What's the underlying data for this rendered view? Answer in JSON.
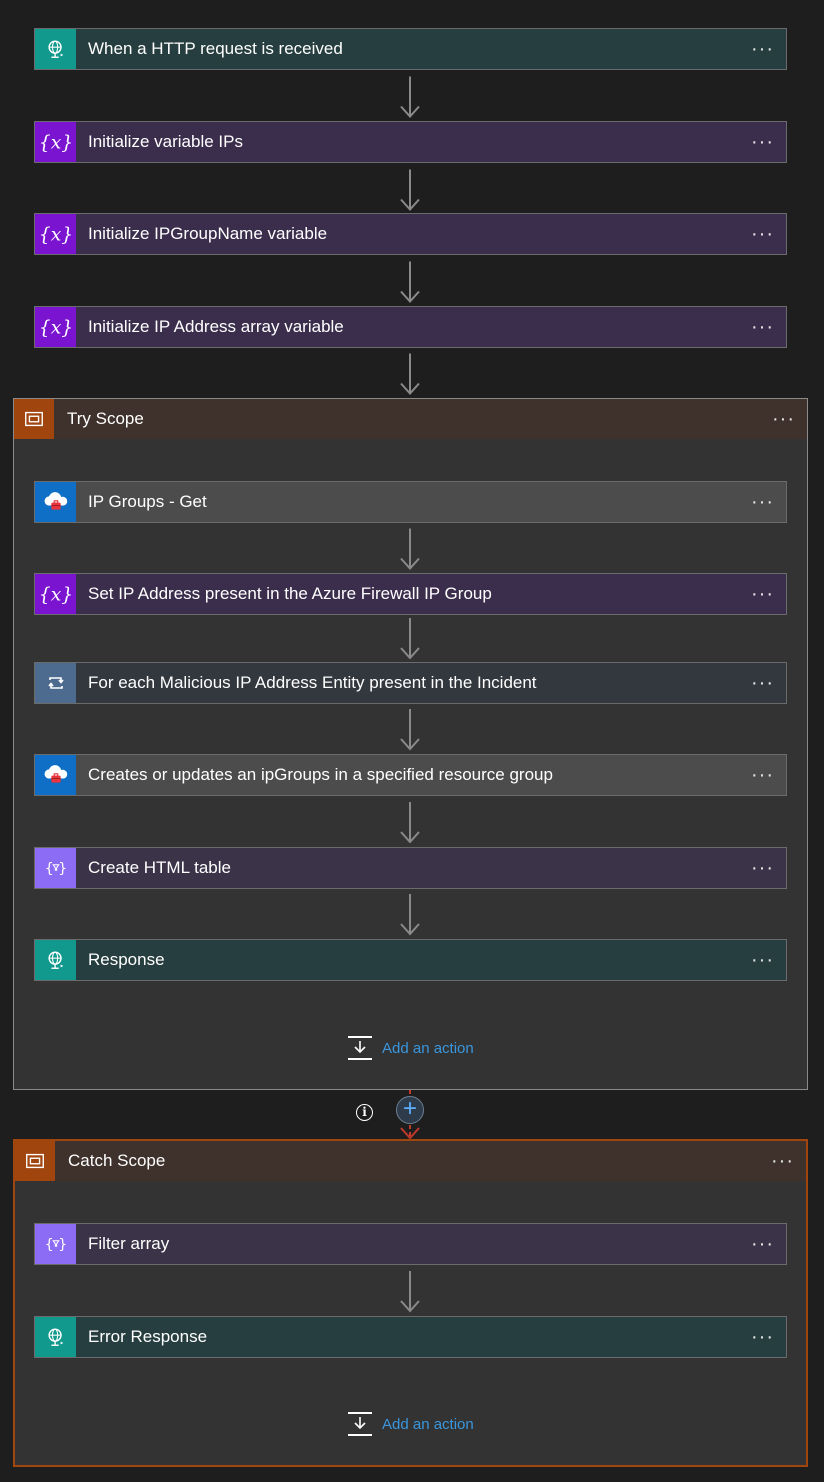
{
  "steps": {
    "http_trigger": "When a HTTP request is received",
    "init_ips": "Initialize variable IPs",
    "init_ipgroupname": "Initialize IPGroupName variable",
    "init_ip_array": "Initialize IP Address array variable"
  },
  "try_scope": {
    "title": "Try Scope",
    "actions": {
      "ip_groups_get": "IP Groups - Get",
      "set_ip_address": "Set IP Address present in the Azure Firewall IP Group",
      "for_each": "For each Malicious IP Address Entity present in the Incident",
      "create_update": "Creates or updates an ipGroups in a specified resource group",
      "create_html": "Create HTML table",
      "response": "Response"
    },
    "add_action": "Add an action"
  },
  "catch_scope": {
    "title": "Catch Scope",
    "actions": {
      "filter_array": "Filter array",
      "error_response": "Error Response"
    },
    "add_action": "Add an action"
  },
  "more_label": "···",
  "info_label": "i",
  "plus_label": "+",
  "colors": {
    "http": "#11998e",
    "variable": "#7a14d1",
    "arm": "#0f6fc6",
    "loop": "#4d6b8f",
    "data_ops": "#8c6cf5",
    "scope": "#a1450f",
    "link": "#3a96dd"
  },
  "icons": {
    "http": "globe-request-icon",
    "variable": "curly-x-icon",
    "arm": "cloud-toolbox-icon",
    "loop": "loop-arrows-icon",
    "data_ops": "curly-filter-icon",
    "scope": "scope-box-icon",
    "add_action": "add-action-icon"
  }
}
